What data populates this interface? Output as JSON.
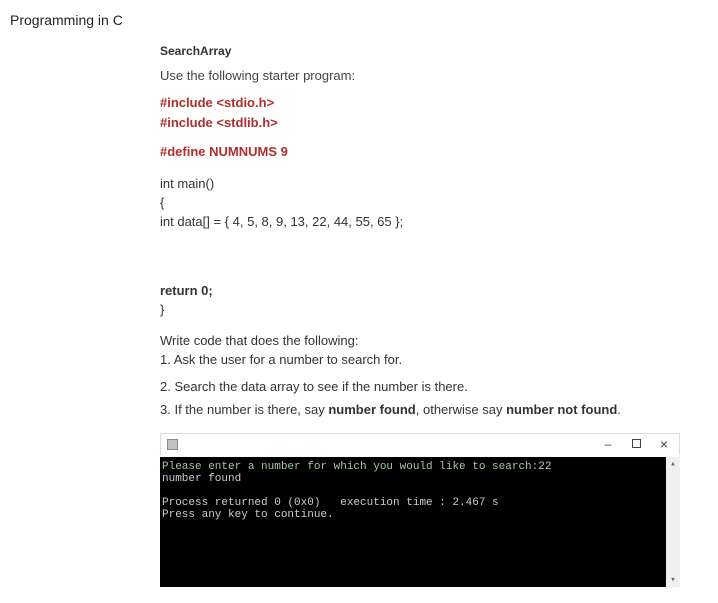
{
  "page": {
    "title": "Programming in C"
  },
  "heading": "SearchArray",
  "starter_label": "Use the following starter program:",
  "code": {
    "inc1": "#include <stdio.h>",
    "inc2": "#include <stdlib.h>",
    "define": "#define NUMNUMS 9",
    "main_decl": "int main()",
    "brace_open": "{",
    "data_line": " int data[] = { 4, 5, 8, 9, 13, 22, 44, 55, 65 };",
    "return_line": "  return 0;",
    "brace_close": "}"
  },
  "tasks": {
    "intro": "Write code that does the following:",
    "item1": "1. Ask the user for a number to search for.",
    "item2_pre": "2. Search the data array to see if the number is there.",
    "item3_pre": "3. If the number is there, say ",
    "item3_mid": "number found",
    "item3_mid2": ", otherwise say ",
    "item3_end": "number not found",
    "item3_dot": "."
  },
  "console": {
    "line1a": "Please enter a number for which you would like to search:",
    "line1b": "22",
    "line2": "number found",
    "line3": "Process returned 0 (0x0)   execution time : 2.467 s",
    "line4": "Press any key to continue."
  }
}
